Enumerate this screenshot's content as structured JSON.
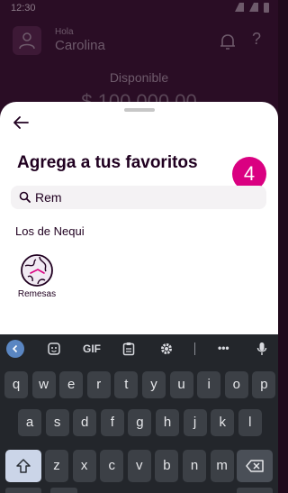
{
  "status_bar": {
    "time": "12:30"
  },
  "background_app": {
    "greeting_small": "Hola",
    "user_name": "Carolina",
    "available_label": "Disponible",
    "balance_text": "$ 100.000,00"
  },
  "sheet": {
    "title": "Agrega a tus favoritos",
    "step_number": "4",
    "search": {
      "value": "Rem"
    },
    "section_label": "Los de Nequi",
    "favorites": [
      {
        "label": "Remesas",
        "icon": "globe-icon"
      }
    ]
  },
  "keyboard": {
    "toolbar": {
      "gif_label": "GIF",
      "more_label": "•••",
      "icons": [
        "chevron-left-icon",
        "sticker-icon",
        "clipboard-icon",
        "gear-icon",
        "microphone-icon"
      ]
    },
    "rows": [
      [
        "q",
        "w",
        "e",
        "r",
        "t",
        "y",
        "u",
        "i",
        "o",
        "p"
      ],
      [
        "a",
        "s",
        "d",
        "f",
        "g",
        "h",
        "j",
        "k",
        "l"
      ],
      [
        "z",
        "x",
        "c",
        "v",
        "b",
        "n",
        "m"
      ]
    ]
  },
  "colors": {
    "brand_pink": "#da0081",
    "title_text": "#200020",
    "keyboard_bg": "#23262b",
    "key_bg": "#3c4046"
  }
}
